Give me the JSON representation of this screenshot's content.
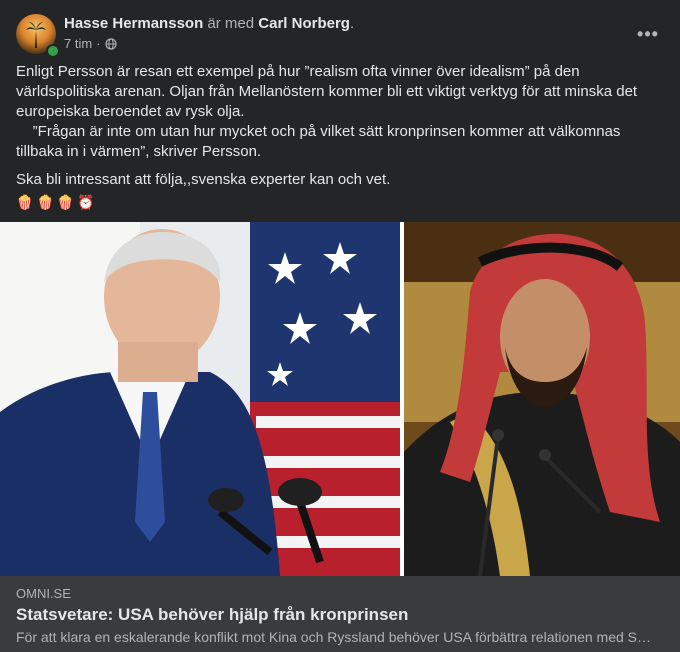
{
  "post": {
    "author": "Hasse Hermansson",
    "with_text": "är med",
    "tagged": "Carl Norberg",
    "tagged_suffix": ".",
    "time": "7 tim",
    "separator": "·",
    "privacy_icon": "globe-icon",
    "more_icon": "more-options-icon",
    "more_label": "•••",
    "paragraphs": [
      "Enligt Persson är resan ett exempel på hur ”realism ofta vinner över idealism” på den världspolitiska arenan. Oljan från Mellanöstern kommer bli ett viktigt verktyg för att minska det europeiska beroendet av rysk olja.",
      "    ”Frågan är inte om utan hur mycket och på vilket sätt kronprinsen kommer att välkomnas tillbaka in i värmen”, skriver Persson.",
      "Ska bli intressant att följa,,svenska experter kan och vet."
    ],
    "emojis": [
      "🍿",
      "🍿",
      "🍿",
      "⏰"
    ]
  },
  "link": {
    "domain": "OMNI.SE",
    "headline": "Statsvetare: USA behöver hjälp från kronprinsen",
    "description": "För att klara en eskalerande konflikt mot Kina och Ryssland behöver USA förbättra relationen med Saudiarabien"
  },
  "colors": {
    "background": "#242526",
    "link_box": "#3a3b3c",
    "primary_text": "#e4e6eb",
    "secondary_text": "#b0b3b8",
    "online": "#31a24c"
  }
}
